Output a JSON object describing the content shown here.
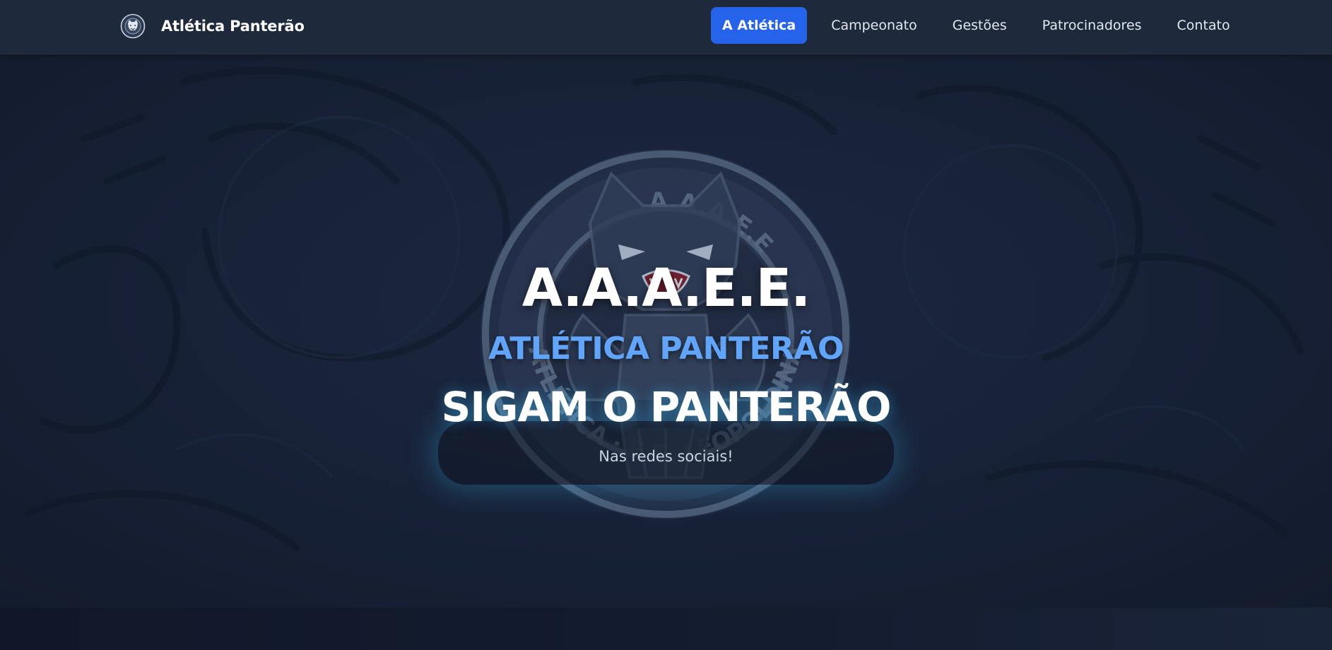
{
  "nav": {
    "brand_name": "Atlética Panterão",
    "brand_icon": "panther-crest-icon",
    "links": [
      {
        "label": "A Atlética",
        "active": true
      },
      {
        "label": "Campeonato",
        "active": false
      },
      {
        "label": "Gestões",
        "active": false
      },
      {
        "label": "Patrocinadores",
        "active": false
      },
      {
        "label": "Contato",
        "active": false
      }
    ]
  },
  "hero": {
    "title": "A.A.A.E.E.",
    "subtitle": "ATLÉTICA PANTERÃO",
    "emblem_text_top": "A.A.A.E.E",
    "emblem_text_bottom": "ATLÉTICA · E.E. LEOPOLDINA",
    "follow_title": "SIGAM O PANTERÃO",
    "follow_subtitle": "Nas redes sociais!"
  },
  "colors": {
    "nav_bg": "#1e293b",
    "active_link_bg": "#2563eb",
    "subtitle": "#60a5fa",
    "hero_bg": "#182238",
    "glow": "#38bdf8"
  }
}
